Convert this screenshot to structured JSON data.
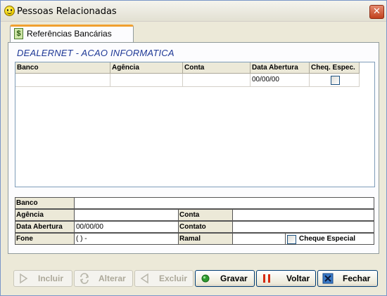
{
  "window": {
    "title": "Pessoas Relacionadas",
    "close_glyph": "✕"
  },
  "tab": {
    "label": "Referências Bancárias",
    "icon": "dollar-icon",
    "icon_glyph": "$"
  },
  "company_name": "DEALERNET - ACAO INFORMATICA",
  "grid": {
    "columns": [
      "Banco",
      "Agência",
      "Conta",
      "Data Abertura",
      "Cheq. Espec."
    ],
    "rows": [
      {
        "banco": "",
        "agencia": "",
        "conta": "",
        "data_abertura": "00/00/00",
        "cheq_espec": false
      }
    ]
  },
  "form": {
    "banco": {
      "label": "Banco",
      "value": ""
    },
    "agencia": {
      "label": "Agência",
      "value": ""
    },
    "conta": {
      "label": "Conta",
      "value": ""
    },
    "data_abertura": {
      "label": "Data Abertura",
      "value": "00/00/00"
    },
    "contato": {
      "label": "Contato",
      "value": ""
    },
    "fone": {
      "label": "Fone",
      "value": "( ) -"
    },
    "ramal": {
      "label": "Ramal",
      "value": ""
    },
    "cheque_especial": {
      "label": "Cheque Especial",
      "checked": false
    }
  },
  "buttons": {
    "incluir": {
      "label": "Incluir",
      "enabled": false
    },
    "alterar": {
      "label": "Alterar",
      "enabled": false
    },
    "excluir": {
      "label": "Excluir",
      "enabled": false
    },
    "gravar": {
      "label": "Gravar",
      "enabled": true
    },
    "voltar": {
      "label": "Voltar",
      "enabled": true
    },
    "fechar": {
      "label": "Fechar",
      "enabled": true
    }
  },
  "colors": {
    "title_accent": "#1e3896",
    "tab_accent": "#f0a030",
    "window_bg": "#ece9d8"
  }
}
